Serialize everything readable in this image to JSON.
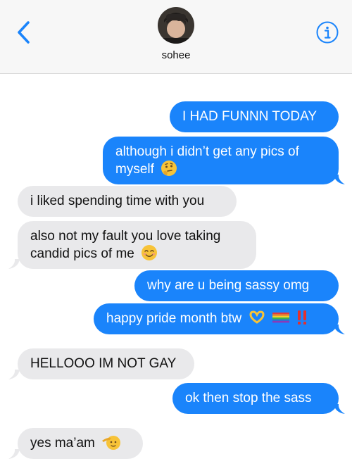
{
  "header": {
    "contact_name": "sohee",
    "back_icon": "chevron-left-icon",
    "info_icon": "info-icon",
    "accent_color": "#1a84fb"
  },
  "messages": [
    {
      "direction": "outgoing",
      "text": "I HAD FUNNN TODAY",
      "emoji": []
    },
    {
      "direction": "outgoing",
      "text": "although i didn’t get any pics of myself",
      "emoji": [
        "thinking-face-emoji"
      ]
    },
    {
      "direction": "incoming",
      "text": "i liked spending time with you",
      "emoji": []
    },
    {
      "direction": "incoming",
      "text": "also not my fault you love taking candid pics of me",
      "emoji": [
        "smiling-face-emoji"
      ]
    },
    {
      "direction": "outgoing",
      "text": "why are u being sassy omg",
      "emoji": []
    },
    {
      "direction": "outgoing",
      "text": "happy pride month btw",
      "emoji": [
        "heart-hands-emoji",
        "rainbow-emoji",
        "double-exclamation-emoji"
      ]
    },
    {
      "direction": "incoming",
      "text": "HELLOOO IM NOT GAY",
      "emoji": []
    },
    {
      "direction": "outgoing",
      "text": "ok then stop the sass",
      "emoji": []
    },
    {
      "direction": "incoming",
      "text": "yes ma’am",
      "emoji": [
        "saluting-face-emoji"
      ]
    }
  ],
  "colors": {
    "outgoing_bubble": "#1a84fb",
    "incoming_bubble": "#e9e9eb",
    "header_bg": "#f7f7f7"
  }
}
